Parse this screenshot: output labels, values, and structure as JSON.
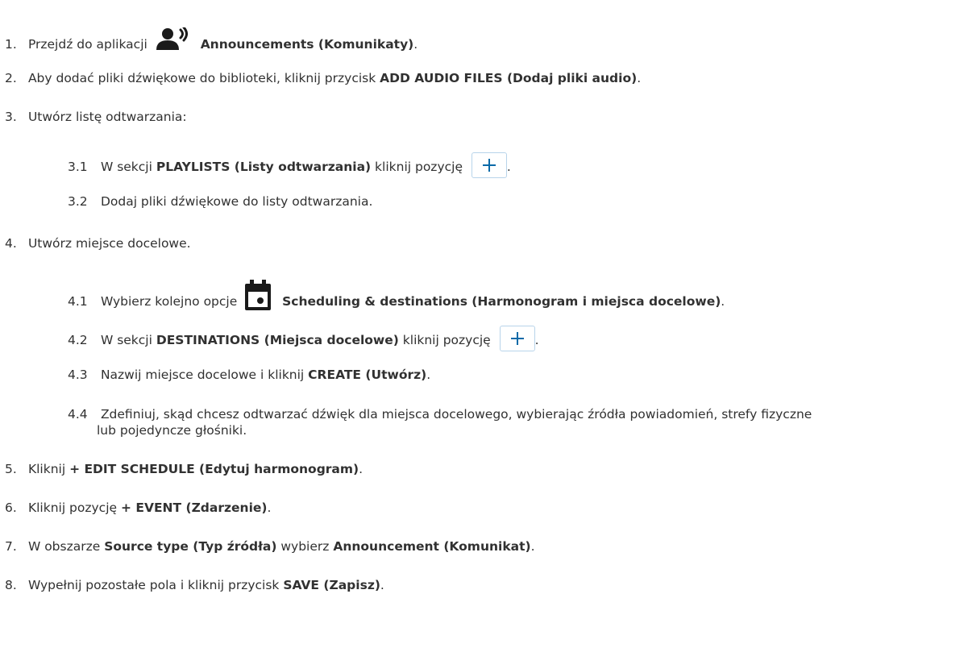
{
  "steps": {
    "s1": {
      "num": "1.",
      "pre": "Przejdź do aplikacji",
      "icon": "speaker-person-icon",
      "bold": "Announcements (Komunikaty)",
      "post": "."
    },
    "s2": {
      "num": "2.",
      "pre": "Aby dodać pliki dźwiękowe do biblioteki, kliknij przycisk ",
      "bold": "ADD AUDIO FILES (Dodaj pliki audio)",
      "post": "."
    },
    "s3": {
      "num": "3.",
      "text": "Utwórz listę odtwarzania:"
    },
    "s3_1": {
      "num": "3.1",
      "pre": "W sekcji ",
      "bold": "PLAYLISTS (Listy odtwarzania)",
      "mid": " kliknij pozycję",
      "icon": "plus-icon",
      "post": "."
    },
    "s3_2": {
      "num": "3.2",
      "text": "Dodaj pliki dźwiękowe do listy odtwarzania."
    },
    "s4": {
      "num": "4.",
      "text": "Utwórz miejsce docelowe."
    },
    "s4_1": {
      "num": "4.1",
      "pre": "Wybierz kolejno opcje",
      "icon": "calendar-icon",
      "bold": "Scheduling & destinations (Harmonogram i miejsca docelowe)",
      "post": "."
    },
    "s4_2": {
      "num": "4.2",
      "pre": "W sekcji ",
      "bold": "DESTINATIONS (Miejsca docelowe)",
      "mid": " kliknij pozycję",
      "icon": "plus-icon",
      "post": "."
    },
    "s4_3": {
      "num": "4.3",
      "pre": "Nazwij miejsce docelowe i kliknij ",
      "bold": "CREATE (Utwórz)",
      "post": "."
    },
    "s4_4": {
      "num": "4.4",
      "line1": "Zdefiniuj, skąd chcesz odtwarzać dźwięk dla miejsca docelowego, wybierając źródła powiadomień, strefy fizyczne",
      "line2": "lub pojedyncze głośniki."
    },
    "s5": {
      "num": "5.",
      "pre": "Kliknij ",
      "bold": "+ EDIT SCHEDULE (Edytuj harmonogram)",
      "post": "."
    },
    "s6": {
      "num": "6.",
      "pre": "Kliknij pozycję ",
      "bold": "+ EVENT (Zdarzenie)",
      "post": "."
    },
    "s7": {
      "num": "7.",
      "pre": "W obszarze ",
      "bold": "Source type (Typ źródła)",
      "mid": " wybierz ",
      "bold2": "Announcement (Komunikat)",
      "post": "."
    },
    "s8": {
      "num": "8.",
      "pre": "Wypełnij pozostałe pola i kliknij przycisk ",
      "bold": "SAVE (Zapisz)",
      "post": "."
    }
  },
  "colors": {
    "text": "#313131",
    "accent": "#0a6aa8",
    "button_border": "#b8d4ea",
    "icon": "#1a1a1a"
  }
}
